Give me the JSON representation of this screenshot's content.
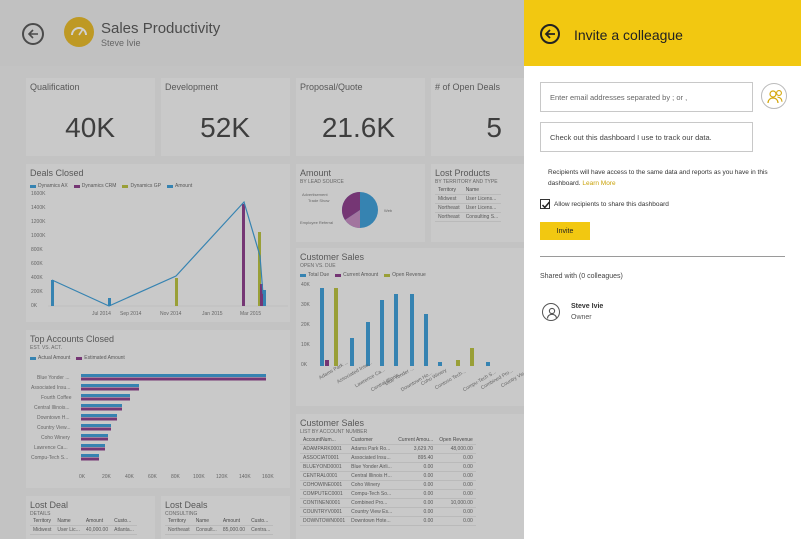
{
  "dashboard": {
    "title": "Sales Productivity",
    "owner": "Steve Ivie",
    "kpis": [
      {
        "label": "Qualification",
        "value": "40K"
      },
      {
        "label": "Development",
        "value": "52K"
      },
      {
        "label": "Proposal/Quote",
        "value": "21.6K"
      },
      {
        "label": "# of Open Deals",
        "value": "5"
      }
    ],
    "deals_closed": {
      "title": "Deals Closed",
      "legend": [
        "Dynamics AX",
        "Dynamics CRM",
        "Dynamics GP",
        "Amount"
      ],
      "y_ticks": [
        "1600K",
        "1400K",
        "1200K",
        "1000K",
        "800K",
        "600K",
        "400K",
        "200K",
        "0K"
      ],
      "x_ticks": [
        "Jul 2014",
        "Sep 2014",
        "Nov 2014",
        "Jan 2015",
        "Mar 2015"
      ]
    },
    "amount": {
      "title": "Amount",
      "subtitle": "BY LEAD SOURCE",
      "labels": [
        "Advertisement",
        "Trade Show",
        "Employee Referral",
        "Web"
      ]
    },
    "lost_products": {
      "title": "Lost Products",
      "subtitle": "BY TERRITORY AND TYPE",
      "headers": [
        "Territory",
        "Name"
      ],
      "rows": [
        [
          "Midwest",
          "User Licens..."
        ],
        [
          "Northeast",
          "User Licens..."
        ],
        [
          "Northeast",
          "Consulting S..."
        ]
      ]
    },
    "customer_sales_chart": {
      "title": "Customer Sales",
      "subtitle": "OPEN VS. DUE",
      "legend": [
        "Total Due",
        "Current Amount",
        "Open Revenue"
      ],
      "y_ticks": [
        "40K",
        "30K",
        "20K",
        "10K",
        "0K"
      ],
      "x_ticks": [
        "Adams Park ...",
        "Associated Insu...",
        "Lawrence Ca...",
        "Central Illinois...",
        "Blue Yonder ...",
        "Downtown Ho...",
        "Coho Winery",
        "Contoso Tech...",
        "Compu-Tech S...",
        "Combined Pro...",
        "Country Vie..."
      ]
    },
    "top_accounts": {
      "title": "Top Accounts Closed",
      "subtitle": "EST. VS. ACT.",
      "legend": [
        "Actual Amount",
        "Estimated Amount"
      ],
      "categories": [
        "Blue Yonder ...",
        "Associated Insu...",
        "Fourth Coffee",
        "Central Illinois...",
        "Downtown H...",
        "Country View...",
        "Coho Winery",
        "Lawrence Ca...",
        "Compu-Tech S..."
      ],
      "x_ticks": [
        "0K",
        "20K",
        "40K",
        "60K",
        "80K",
        "100K",
        "120K",
        "140K",
        "160K"
      ]
    },
    "customer_sales_table": {
      "title": "Customer Sales",
      "subtitle": "LIST BY ACCOUNT NUMBER",
      "headers": [
        "AccountNum...",
        "Customer",
        "Current Amou...",
        "Open Revenue"
      ],
      "rows": [
        [
          "ADAMPARK0001",
          "Adams Park Ro...",
          "3,629.70",
          "48,000.00"
        ],
        [
          "ASSOCIAT0001",
          "Associated Insu...",
          "895.40",
          "0.00"
        ],
        [
          "BLUEYOND0001",
          "Blue Yonder Airli...",
          "0.00",
          "0.00"
        ],
        [
          "CENTRAL0001",
          "Central Illinois H...",
          "0.00",
          "0.00"
        ],
        [
          "COHOWINE0001",
          "Coho Winery",
          "0.00",
          "0.00"
        ],
        [
          "COMPUTEC0001",
          "Compu-Tech So...",
          "0.00",
          "0.00"
        ],
        [
          "CONTINEN0001",
          "Combined Pro...",
          "0.00",
          "10,000.00"
        ],
        [
          "COUNTRYV0001",
          "Country View Es...",
          "0.00",
          "0.00"
        ],
        [
          "DOWNTOWN0001",
          "Downtown Hote...",
          "0.00",
          "0.00"
        ]
      ]
    },
    "lost_deal": {
      "title": "Lost Deal",
      "subtitle": "DETAILS",
      "headers": [
        "Territory",
        "Name",
        "Amount",
        "Custo..."
      ],
      "row": [
        "Midwest",
        "User Lic...",
        "40,000.00",
        "Atlanta..."
      ]
    },
    "lost_deals": {
      "title": "Lost Deals",
      "subtitle": "CONSULTING",
      "headers": [
        "Territory",
        "Name",
        "Amount",
        "Custo..."
      ],
      "row": [
        "Northeast",
        "Consult...",
        "85,000.00",
        "Centra..."
      ]
    }
  },
  "invite": {
    "title": "Invite a colleague",
    "email_placeholder": "Enter email addresses separated by ; or ,",
    "message": "Check out this dashboard I use to track our data.",
    "notice": "Recipients will have access to the same data and reports as you have in this dashboard.",
    "learn_more": "Learn More",
    "allow_share_label": "Allow recipients to share this dashboard",
    "allow_share_checked": true,
    "invite_button": "Invite",
    "shared_with": "Shared with (0 colleagues)",
    "person": {
      "name": "Steve Ivie",
      "role": "Owner"
    }
  },
  "colors": {
    "accent_yellow": "#f2c811",
    "series_blue": "#3a9dd8",
    "series_purple": "#8b3a8a",
    "series_olive": "#b9c13b"
  }
}
